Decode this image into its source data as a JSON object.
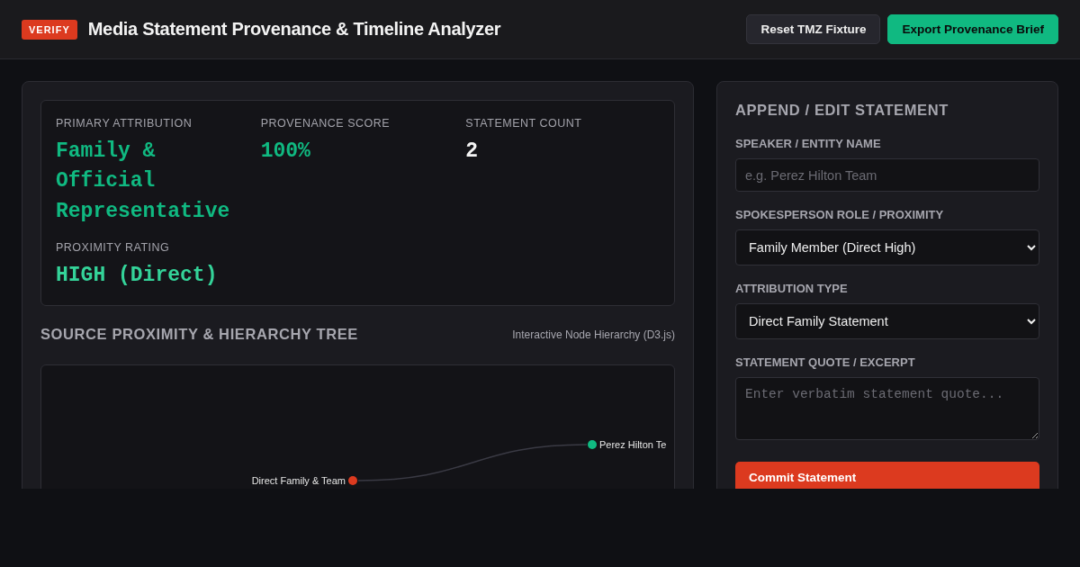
{
  "header": {
    "badge": "VERIFY",
    "title": "Media Statement Provenance & Timeline Analyzer",
    "buttons": [
      {
        "label": "Reset TMZ Fixture",
        "kind": "secondary"
      },
      {
        "label": "Export Provenance Brief",
        "kind": "primary"
      }
    ]
  },
  "summary": {
    "stats": [
      {
        "label": "PRIMARY ATTRIBUTION",
        "value": "Family & Official Representative",
        "kind": "accent"
      },
      {
        "label": "PROVENANCE SCORE",
        "value": "100%",
        "kind": "accent"
      },
      {
        "label": "STATEMENT COUNT",
        "value": "2",
        "kind": "plain"
      }
    ],
    "proximity": {
      "label": "PROXIMITY RATING",
      "value": "HIGH (Direct)"
    }
  },
  "tree": {
    "title": "SOURCE PROXIMITY & HIERARCHY TREE",
    "subtitle": "Interactive Node Hierarchy (D3.js)",
    "root": {
      "label": "Direct Family & Team",
      "color": "#dc3a1f",
      "children": [
        {
          "label": "Perez Hilton Te",
          "color": "#10b981"
        }
      ]
    }
  },
  "form": {
    "title": "APPEND / EDIT STATEMENT",
    "fields": [
      {
        "kind": "text",
        "label": "SPEAKER / ENTITY NAME",
        "placeholder": "e.g. Perez Hilton Team"
      },
      {
        "kind": "select",
        "label": "SPOKESPERSON ROLE / PROXIMITY",
        "value": "Family Member (Direct High)"
      },
      {
        "kind": "select",
        "label": "ATTRIBUTION TYPE",
        "value": "Direct Family Statement"
      },
      {
        "kind": "textarea",
        "label": "STATEMENT QUOTE / EXCERPT",
        "placeholder": "Enter verbatim statement quote..."
      }
    ],
    "submit": "Commit Statement"
  }
}
